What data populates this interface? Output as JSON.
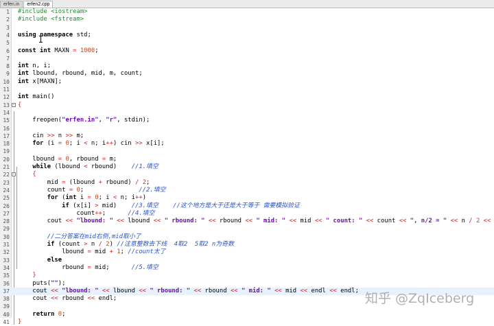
{
  "tabs": [
    {
      "label": "erfen.in",
      "active": false
    },
    {
      "label": "erfen2.cpp",
      "active": true
    }
  ],
  "current_line": 37,
  "lines": [
    {
      "n": 1,
      "fold": "",
      "tokens": [
        [
          "pp",
          "#include <iostream>"
        ]
      ]
    },
    {
      "n": 2,
      "fold": "",
      "tokens": [
        [
          "pp",
          "#include <fstream>"
        ]
      ]
    },
    {
      "n": 3,
      "fold": "",
      "tokens": []
    },
    {
      "n": 4,
      "fold": "",
      "tokens": [
        [
          "kw",
          "using"
        ],
        [
          "t",
          " "
        ],
        [
          "kw",
          "namespace"
        ],
        [
          "t",
          " std;"
        ]
      ]
    },
    {
      "n": 5,
      "fold": "",
      "tokens": []
    },
    {
      "n": 6,
      "fold": "",
      "tokens": [
        [
          "kw",
          "const int"
        ],
        [
          "t",
          " MAXN "
        ],
        [
          "op",
          "="
        ],
        [
          "t",
          " "
        ],
        [
          "num",
          "1000"
        ],
        [
          "t",
          ";"
        ]
      ]
    },
    {
      "n": 7,
      "fold": "",
      "tokens": []
    },
    {
      "n": 8,
      "fold": "",
      "tokens": [
        [
          "kw",
          "int"
        ],
        [
          "t",
          " n, i;"
        ]
      ]
    },
    {
      "n": 9,
      "fold": "",
      "tokens": [
        [
          "kw",
          "int"
        ],
        [
          "t",
          " lbound, rbound, mid, m, count;"
        ]
      ]
    },
    {
      "n": 10,
      "fold": "",
      "tokens": [
        [
          "kw",
          "int"
        ],
        [
          "t",
          " x[MAXN];"
        ]
      ]
    },
    {
      "n": 11,
      "fold": "",
      "tokens": []
    },
    {
      "n": 12,
      "fold": "",
      "tokens": [
        [
          "kw",
          "int"
        ],
        [
          "t",
          " main()"
        ]
      ]
    },
    {
      "n": 13,
      "fold": "-",
      "tokens": [
        [
          "op",
          "{"
        ]
      ]
    },
    {
      "n": 14,
      "fold": "",
      "tokens": []
    },
    {
      "n": 15,
      "fold": "",
      "tokens": [
        [
          "t",
          "    freopen("
        ],
        [
          "str",
          "\"erfen.in\""
        ],
        [
          "t",
          ", "
        ],
        [
          "str",
          "\"r\""
        ],
        [
          "t",
          ", stdin);"
        ]
      ]
    },
    {
      "n": 16,
      "fold": "",
      "tokens": []
    },
    {
      "n": 17,
      "fold": "",
      "tokens": [
        [
          "t",
          "    cin "
        ],
        [
          "op",
          ">>"
        ],
        [
          "t",
          " n "
        ],
        [
          "op",
          ">>"
        ],
        [
          "t",
          " m;"
        ]
      ]
    },
    {
      "n": 18,
      "fold": "",
      "tokens": [
        [
          "t",
          "    "
        ],
        [
          "kw",
          "for"
        ],
        [
          "t",
          " (i "
        ],
        [
          "op",
          "="
        ],
        [
          "t",
          " "
        ],
        [
          "num",
          "0"
        ],
        [
          "t",
          "; i "
        ],
        [
          "op",
          "<"
        ],
        [
          "t",
          " n; i"
        ],
        [
          "op",
          "++"
        ],
        [
          "t",
          ") cin "
        ],
        [
          "op",
          ">>"
        ],
        [
          "t",
          " x[i];"
        ]
      ]
    },
    {
      "n": 19,
      "fold": "",
      "tokens": []
    },
    {
      "n": 20,
      "fold": "",
      "tokens": [
        [
          "t",
          "    lbound "
        ],
        [
          "op",
          "="
        ],
        [
          "t",
          " "
        ],
        [
          "num",
          "0"
        ],
        [
          "t",
          ", rbound "
        ],
        [
          "op",
          "="
        ],
        [
          "t",
          " m;"
        ]
      ]
    },
    {
      "n": 21,
      "fold": "",
      "tokens": [
        [
          "t",
          "    "
        ],
        [
          "kw",
          "while"
        ],
        [
          "t",
          " (lbound "
        ],
        [
          "op",
          "<"
        ],
        [
          "t",
          " rbound)    "
        ],
        [
          "cmt",
          "//1.填空"
        ]
      ]
    },
    {
      "n": 22,
      "fold": "-",
      "tokens": [
        [
          "t",
          "    "
        ],
        [
          "op",
          "{"
        ]
      ]
    },
    {
      "n": 23,
      "fold": "",
      "tokens": [
        [
          "t",
          "        mid "
        ],
        [
          "op",
          "="
        ],
        [
          "t",
          " (lbound "
        ],
        [
          "op",
          "+"
        ],
        [
          "t",
          " rbound) "
        ],
        [
          "op",
          "/"
        ],
        [
          "t",
          " "
        ],
        [
          "num",
          "2"
        ],
        [
          "t",
          ";"
        ]
      ]
    },
    {
      "n": 24,
      "fold": "",
      "tokens": [
        [
          "t",
          "        count "
        ],
        [
          "op",
          "="
        ],
        [
          "t",
          " "
        ],
        [
          "num",
          "0"
        ],
        [
          "t",
          ";               "
        ],
        [
          "cmt",
          "//2.填空"
        ]
      ]
    },
    {
      "n": 25,
      "fold": "",
      "tokens": [
        [
          "t",
          "        "
        ],
        [
          "kw",
          "for"
        ],
        [
          "t",
          " ("
        ],
        [
          "kw",
          "int"
        ],
        [
          "t",
          " i "
        ],
        [
          "op",
          "="
        ],
        [
          "t",
          " "
        ],
        [
          "num",
          "0"
        ],
        [
          "t",
          "; i "
        ],
        [
          "op",
          "<"
        ],
        [
          "t",
          " n; i"
        ],
        [
          "op",
          "++"
        ],
        [
          "t",
          ")"
        ]
      ]
    },
    {
      "n": 26,
      "fold": "",
      "tokens": [
        [
          "t",
          "            "
        ],
        [
          "kw",
          "if"
        ],
        [
          "t",
          " (x[i] "
        ],
        [
          "op",
          ">"
        ],
        [
          "t",
          " mid)    "
        ],
        [
          "cmt",
          "//3.填空    //这个地方是大于还是大于等于 需要模拟验证"
        ]
      ]
    },
    {
      "n": 27,
      "fold": "",
      "tokens": [
        [
          "t",
          "                count"
        ],
        [
          "op",
          "++"
        ],
        [
          "t",
          ";      "
        ],
        [
          "cmt",
          "//4.填空"
        ]
      ]
    },
    {
      "n": 28,
      "fold": "",
      "tokens": [
        [
          "t",
          "        cout "
        ],
        [
          "op",
          "<<"
        ],
        [
          "t",
          " "
        ],
        [
          "str",
          "\"lbound: \""
        ],
        [
          "t",
          " "
        ],
        [
          "op",
          "<<"
        ],
        [
          "t",
          " lbound "
        ],
        [
          "op",
          "<<"
        ],
        [
          "t",
          " "
        ],
        [
          "str",
          "\" rbound: \""
        ],
        [
          "t",
          " "
        ],
        [
          "op",
          "<<"
        ],
        [
          "t",
          " rbound "
        ],
        [
          "op",
          "<<"
        ],
        [
          "t",
          " "
        ],
        [
          "str",
          "\" mid: \""
        ],
        [
          "t",
          " "
        ],
        [
          "op",
          "<<"
        ],
        [
          "t",
          " mid "
        ],
        [
          "op",
          "<<"
        ],
        [
          "t",
          " "
        ],
        [
          "str",
          "\" count: \""
        ],
        [
          "t",
          " "
        ],
        [
          "op",
          "<<"
        ],
        [
          "t",
          " count "
        ],
        [
          "op",
          "<<"
        ],
        [
          "t",
          " "
        ],
        [
          "str",
          "\", n/2 = \""
        ],
        [
          "t",
          " "
        ],
        [
          "op",
          "<<"
        ],
        [
          "t",
          " n "
        ],
        [
          "op",
          "/"
        ],
        [
          "t",
          " "
        ],
        [
          "num",
          "2"
        ],
        [
          "t",
          " "
        ],
        [
          "op",
          "<<"
        ],
        [
          "t",
          " endl;"
        ]
      ]
    },
    {
      "n": 29,
      "fold": "",
      "tokens": []
    },
    {
      "n": 30,
      "fold": "",
      "tokens": [
        [
          "t",
          "        "
        ],
        [
          "cmt",
          "//二分答案在mid右侧,mid取小了"
        ]
      ]
    },
    {
      "n": 31,
      "fold": "",
      "tokens": [
        [
          "t",
          "        "
        ],
        [
          "kw",
          "if"
        ],
        [
          "t",
          " (count "
        ],
        [
          "op",
          ">"
        ],
        [
          "t",
          " n "
        ],
        [
          "op",
          "/"
        ],
        [
          "t",
          " "
        ],
        [
          "num",
          "2"
        ],
        [
          "t",
          ") "
        ],
        [
          "cmt",
          "//注意整数去下线  4取2  5取2 n为奇数"
        ]
      ]
    },
    {
      "n": 32,
      "fold": "",
      "tokens": [
        [
          "t",
          "            lbound "
        ],
        [
          "op",
          "="
        ],
        [
          "t",
          " mid "
        ],
        [
          "op",
          "+"
        ],
        [
          "t",
          " "
        ],
        [
          "num",
          "1"
        ],
        [
          "t",
          "; "
        ],
        [
          "cmt",
          "//count太了"
        ]
      ]
    },
    {
      "n": 33,
      "fold": "",
      "tokens": [
        [
          "t",
          "        "
        ],
        [
          "kw",
          "else"
        ]
      ]
    },
    {
      "n": 34,
      "fold": "",
      "tokens": [
        [
          "t",
          "            rbound "
        ],
        [
          "op",
          "="
        ],
        [
          "t",
          " mid;      "
        ],
        [
          "cmt",
          "//5.填空"
        ]
      ]
    },
    {
      "n": 35,
      "fold": "",
      "tokens": [
        [
          "t",
          "    "
        ],
        [
          "op",
          "}"
        ]
      ]
    },
    {
      "n": 36,
      "fold": "",
      "tokens": [
        [
          "t",
          "    puts("
        ],
        [
          "str",
          "\"\""
        ],
        [
          "t",
          ");"
        ]
      ]
    },
    {
      "n": 37,
      "fold": "",
      "tokens": [
        [
          "t",
          "    cout "
        ],
        [
          "op",
          "<<"
        ],
        [
          "t",
          " "
        ],
        [
          "str",
          "\"lbound: \""
        ],
        [
          "t",
          " "
        ],
        [
          "op",
          "<<"
        ],
        [
          "t",
          " lbound "
        ],
        [
          "op",
          "<<"
        ],
        [
          "t",
          " "
        ],
        [
          "str",
          "\" rbound: \""
        ],
        [
          "t",
          " "
        ],
        [
          "op",
          "<<"
        ],
        [
          "t",
          " rbound "
        ],
        [
          "op",
          "<<"
        ],
        [
          "t",
          " "
        ],
        [
          "str",
          "\" mid: \""
        ],
        [
          "t",
          " "
        ],
        [
          "op",
          "<<"
        ],
        [
          "t",
          " mid "
        ],
        [
          "op",
          "<<"
        ],
        [
          "t",
          " endl "
        ],
        [
          "op",
          "<<"
        ],
        [
          "t",
          " endl;"
        ]
      ]
    },
    {
      "n": 38,
      "fold": "",
      "tokens": [
        [
          "t",
          "    cout "
        ],
        [
          "op",
          "<<"
        ],
        [
          "t",
          " rbound "
        ],
        [
          "op",
          "<<"
        ],
        [
          "t",
          " endl;"
        ]
      ]
    },
    {
      "n": 39,
      "fold": "",
      "tokens": []
    },
    {
      "n": 40,
      "fold": "",
      "tokens": [
        [
          "t",
          "    "
        ],
        [
          "kw",
          "return"
        ],
        [
          "t",
          " "
        ],
        [
          "num",
          "0"
        ],
        [
          "t",
          ";"
        ]
      ]
    },
    {
      "n": 41,
      "fold": "",
      "tokens": [
        [
          "op",
          "}"
        ]
      ]
    }
  ],
  "watermark": "知乎 @ZqIceberg",
  "colors": {
    "keyword": "#000000",
    "preprocessor": "#218a2e",
    "number": "#d1410e",
    "string": "#6a0dad",
    "operator": "#c62828",
    "comment": "#2a55c8",
    "current_line_bg": "#e8f2fe"
  }
}
